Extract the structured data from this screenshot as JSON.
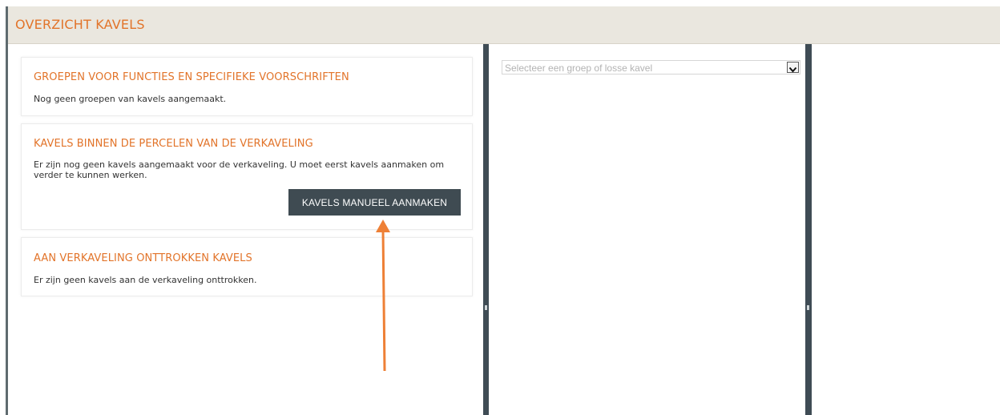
{
  "header": {
    "title": "OVERZICHT KAVELS"
  },
  "cards": [
    {
      "title": "GROEPEN VOOR FUNCTIES EN SPECIFIEKE VOORSCHRIFTEN",
      "text": "Nog geen groepen van kavels aangemaakt."
    },
    {
      "title": "KAVELS BINNEN DE PERCELEN VAN DE VERKAVELING",
      "text": "Er zijn nog geen kavels aangemaakt voor de verkaveling. U moet eerst kavels aanmaken om verder te kunnen werken.",
      "button_label": "KAVELS MANUEEL AANMAKEN"
    },
    {
      "title": "AAN VERKAVELING ONTTROKKEN KAVELS",
      "text": "Er zijn geen kavels aan de verkaveling onttrokken."
    }
  ],
  "group_select": {
    "placeholder": "Selecteer een groep of losse kavel"
  },
  "colors": {
    "accent_orange": "#e2742a",
    "header_bg": "#eae7df",
    "button_bg": "#3f4b52",
    "divider": "#3f4c55",
    "annotation_arrow": "#ee8036"
  },
  "icons": {
    "select_arrow": "chevron-down-icon",
    "annotation": "up-arrow-icon"
  }
}
